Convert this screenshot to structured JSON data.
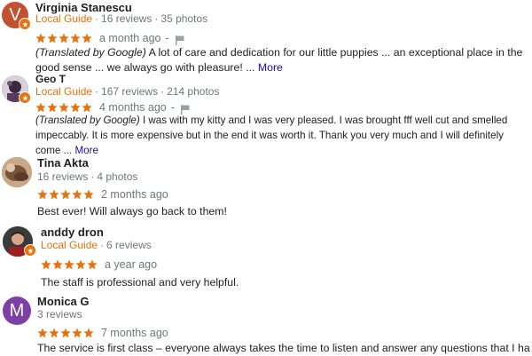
{
  "reviews": [
    {
      "name": "Virginia Stanescu",
      "avatar_letter": "V",
      "avatar_color": "#c3512f",
      "local_guide": "Local Guide",
      "reviews_count": "16 reviews",
      "photos_count": "35 photos",
      "stars": 5,
      "time": "a month ago",
      "translated_prefix": "(Translated by Google)",
      "text_line1": "A lot of care and dedication for our little puppies ... an exceptional place in the",
      "text_line2": "good sense ... we always go with pleasure! ...",
      "more": "More"
    },
    {
      "name": "Geo T",
      "avatar_color": "#5a3b5e",
      "local_guide": "Local Guide",
      "reviews_count": "167 reviews",
      "photos_count": "214 photos",
      "stars": 5,
      "time": "4 months ago",
      "translated_prefix": "(Translated by Google)",
      "text_line1": "I was with my kitty and I was very pleased. I was brought fff well cut and smelled",
      "text_line2": "impeccably. It is more expensive but in the end it was worth it. Thank you very much and I will definitely",
      "text_line3": "come ...",
      "more": "More"
    },
    {
      "name": "Tina Akta",
      "avatar_color": "#8a6a50",
      "reviews_count": "16 reviews",
      "photos_count": "4 photos",
      "stars": 5,
      "time": "2 months ago",
      "text": "Best ever! Will always go back to them!"
    },
    {
      "name": "anddy dron",
      "avatar_color": "#6b2a22",
      "local_guide": "Local Guide",
      "reviews_count": "6 reviews",
      "stars": 5,
      "time": "a year ago",
      "text": "The staff is professional and very helpful."
    },
    {
      "name": "Monica G",
      "avatar_letter": "M",
      "avatar_color": "#7b3fa6",
      "reviews_count": "3 reviews",
      "stars": 5,
      "time": "7 months ago",
      "text": "The service is first class – everyone always takes the time to listen and answer any questions that I have"
    }
  ],
  "colors": {
    "star": "#e8710a",
    "local_guide": "#e8710a",
    "link": "#1a0dab",
    "meta": "#70757a"
  },
  "icons": {
    "star": "star-icon",
    "flag": "flag-icon",
    "badge": "local-guide-badge-icon"
  }
}
